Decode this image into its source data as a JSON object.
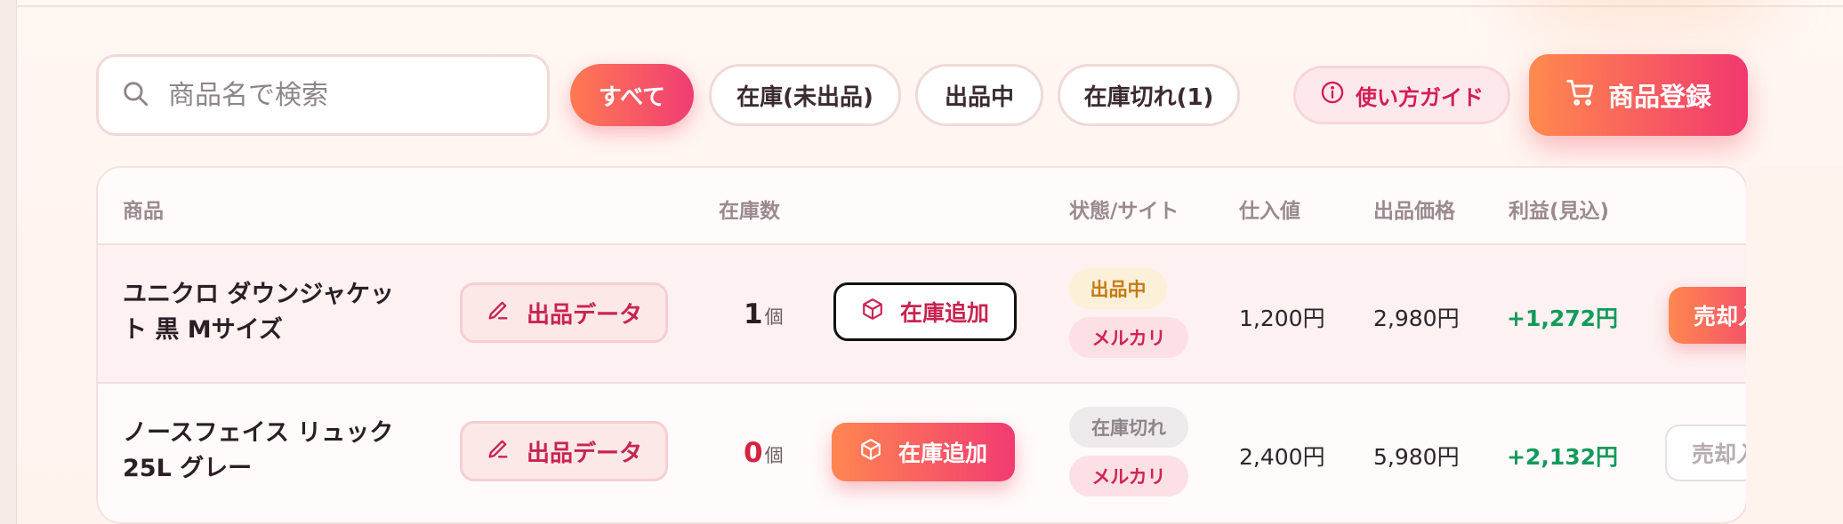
{
  "toolbar": {
    "search_placeholder": "商品名で検索",
    "filters": [
      {
        "label": "すべて",
        "active": true
      },
      {
        "label": "在庫(未出品)",
        "active": false
      },
      {
        "label": "出品中",
        "active": false
      },
      {
        "label": "在庫切れ(1)",
        "active": false
      }
    ],
    "guide_label": "使い方ガイド",
    "register_label": "商品登録"
  },
  "table": {
    "headers": {
      "product": "商品",
      "stock": "在庫数",
      "status_site": "状態/サイト",
      "cost": "仕入値",
      "price": "出品価格",
      "profit": "利益(見込)"
    },
    "rows": [
      {
        "name": "ユニクロ ダウンジャケット 黒 Mサイズ",
        "edit_label": "出品データ",
        "qty": "1",
        "qty_unit": "個",
        "add_stock_label": "在庫追加",
        "status": "出品中",
        "site": "メルカリ",
        "cost": "1,200円",
        "price": "2,980円",
        "profit": "+1,272円",
        "sell_label": "売却入力"
      },
      {
        "name": "ノースフェイス リュック 25L グレー",
        "edit_label": "出品データ",
        "qty": "0",
        "qty_unit": "個",
        "add_stock_label": "在庫追加",
        "status": "在庫切れ",
        "site": "メルカリ",
        "cost": "2,400円",
        "price": "5,980円",
        "profit": "+2,132円",
        "sell_label": "売却入力"
      }
    ]
  },
  "colors": {
    "accent_start": "#ff8a4e",
    "accent_end": "#f2386f",
    "profit": "#139a5c",
    "zero_qty": "#d6233f"
  }
}
